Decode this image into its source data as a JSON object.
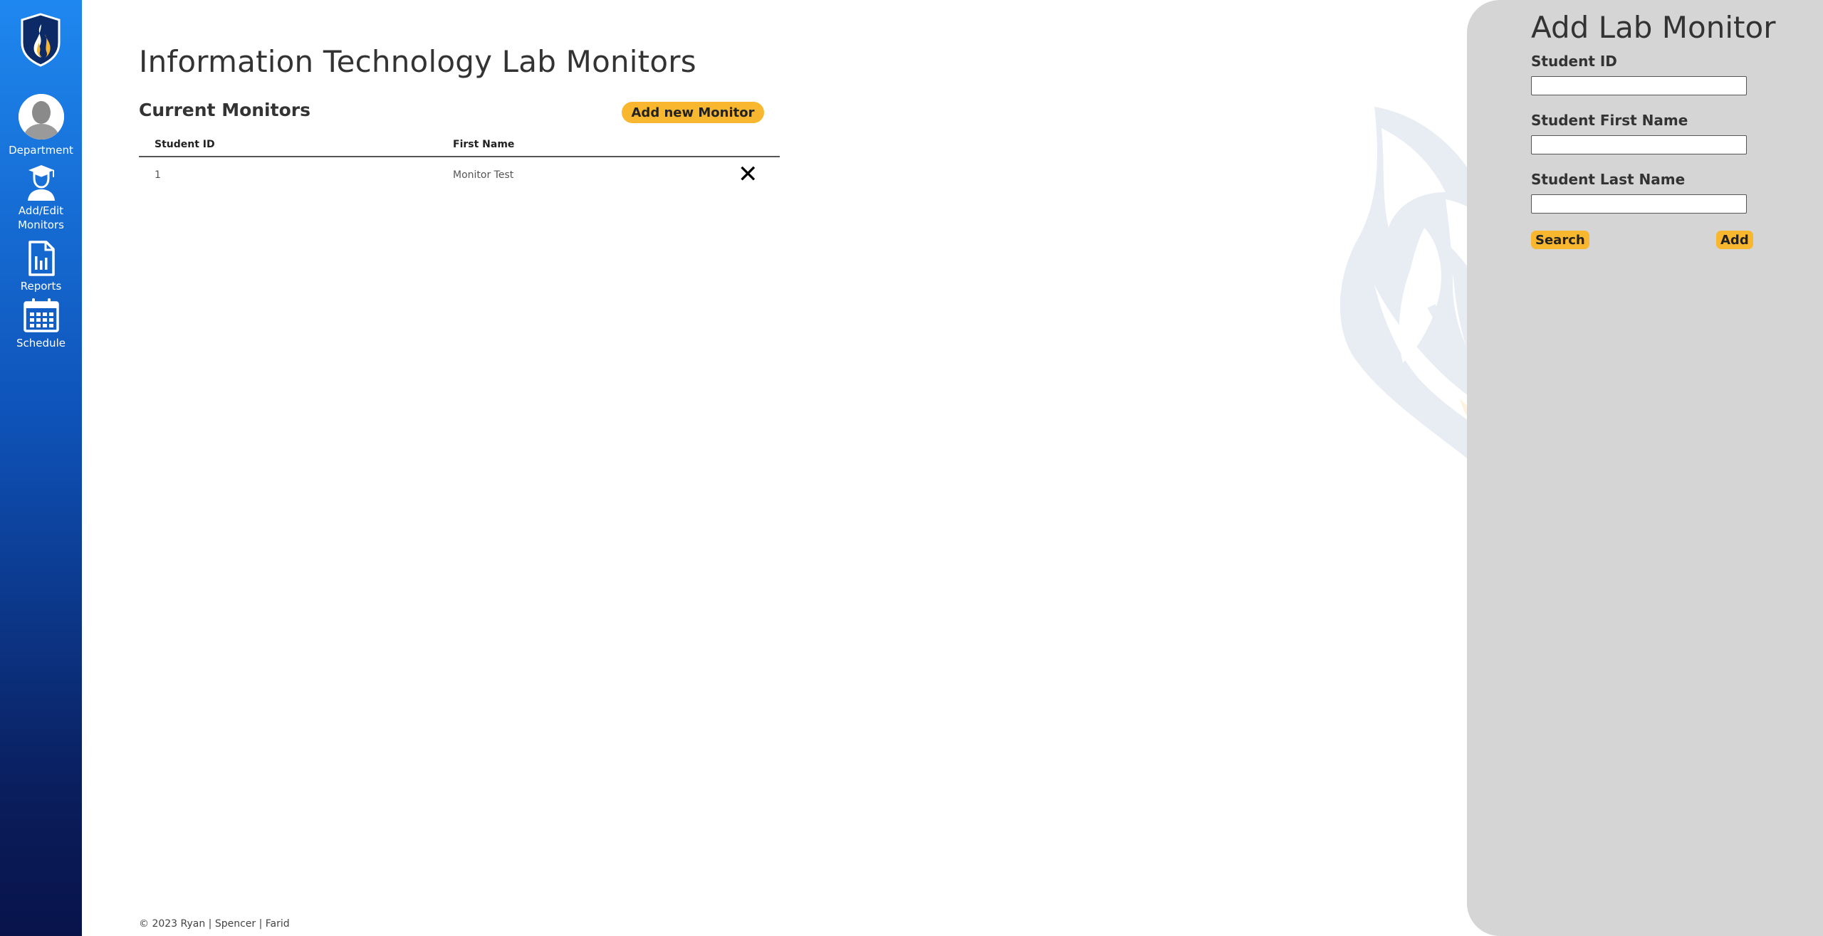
{
  "sidebar": {
    "items": [
      {
        "label": "Department",
        "icon": "avatar"
      },
      {
        "label": "Add/Edit Monitors",
        "icon": "graduate-icon"
      },
      {
        "label": "Reports",
        "icon": "report-icon"
      },
      {
        "label": "Schedule",
        "icon": "calendar-icon"
      }
    ]
  },
  "main": {
    "title": "Information Technology Lab Monitors",
    "subtitle": "Current Monitors",
    "add_button": "Add new Monitor",
    "table": {
      "headers": [
        "Student ID",
        "First Name"
      ],
      "rows": [
        {
          "student_id": "1",
          "first_name": "Monitor Test",
          "delete": "✕"
        }
      ]
    }
  },
  "footer": "© 2023 Ryan | Spencer | Farid",
  "panel": {
    "title": "Add Lab Monitor",
    "fields": [
      {
        "label": "Student ID",
        "value": ""
      },
      {
        "label": "Student First Name",
        "value": ""
      },
      {
        "label": "Student Last Name",
        "value": ""
      }
    ],
    "search_button": "Search",
    "add_button": "Add"
  },
  "colors": {
    "accent": "#f8b72e",
    "sidebar_top": "#1e88f0",
    "sidebar_bottom": "#08134a",
    "panel_bg": "#d5d5d5"
  }
}
